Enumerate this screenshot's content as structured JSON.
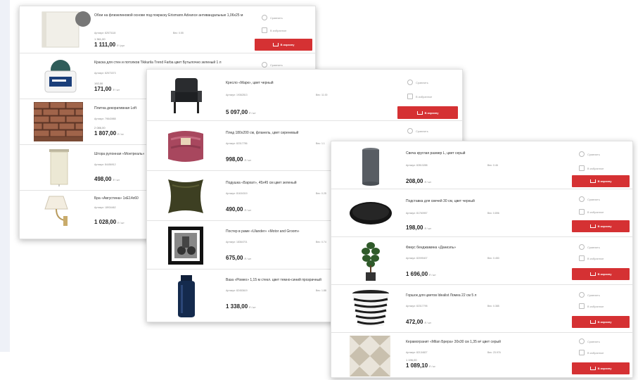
{
  "actions": {
    "compare": "Сравнить",
    "favorite": "В избранное",
    "cart": "В корзину"
  },
  "panel1": {
    "badge": "",
    "rows": [
      {
        "title": "Обои на флизелиновой основе под покраску Erismann Advance антивандальные 1,06х25 м",
        "sku": "Артикул: 82573118",
        "size": "Вес: 0.55",
        "oldprice": "1 361,00",
        "price": "1 111,00",
        "unit": "₽ / рул"
      },
      {
        "title": "Краска для стен и потолков Tikkurila Trend Farba цвет Бутылочно зеленый 1 л",
        "sku": "Артикул: 82573373",
        "size": "",
        "oldprice": "192,00",
        "price": "171,00",
        "unit": "₽ / шт"
      },
      {
        "title": "Плитка декоративная Loft",
        "sku": "Артикул: 79843988",
        "size": "",
        "oldprice": "2 086,00",
        "price": "1 807,00",
        "unit": "₽ / м²"
      },
      {
        "title": "Штора рулонная «Монтреаль»",
        "sku": "Артикул: 84456912",
        "size": "",
        "oldprice": "",
        "price": "498,00",
        "unit": "₽ / шт"
      },
      {
        "title": "Бра «Августина» 1xE14x60",
        "sku": "Артикул: 18934462",
        "size": "",
        "oldprice": "",
        "price": "1 028,00",
        "unit": "₽ / шт"
      }
    ]
  },
  "panel2": {
    "rows": [
      {
        "title": "Кресло «Марк», цвет черный",
        "sku": "Артикул: 19362813",
        "size": "Вес: 11.00",
        "price": "5 097,00",
        "unit": "₽ / шт"
      },
      {
        "title": "Плед 180х200 см, фланель, цвет сиреневый",
        "sku": "Артикул: 82317786",
        "size": "Вес: 1.1",
        "price": "998,00",
        "unit": "₽ / шт"
      },
      {
        "title": "Подушка «Бархат», 45х45 см цвет зеленый",
        "sku": "Артикул: 81634319",
        "size": "Вес: 0.25",
        "price": "490,00",
        "unit": "₽ / шт"
      },
      {
        "title": "Постер в раме «Ulander» «Motor and Groom»",
        "sku": "Артикул: 18364701",
        "size": "Вес: 0.74",
        "price": "675,00",
        "unit": "₽ / шт"
      },
      {
        "title": "Ваза «Ромео» 1,15 м стекл. цвет темно-синий прозрачный",
        "sku": "Артикул: 82453619",
        "size": "Вес: 1.88",
        "price": "1 338,00",
        "unit": "₽ / шт"
      }
    ]
  },
  "panel3": {
    "rows": [
      {
        "title": "Свеча круглая размер L, цвет серый",
        "sku": "Артикул: 82813288",
        "size": "Вес: 0.46",
        "oldprice": "",
        "price": "208,00",
        "unit": "₽ / шт"
      },
      {
        "title": "Подставка для свечей 30 см, цвет черный",
        "sku": "Артикул: 81760957",
        "size": "Вес: 0.896",
        "oldprice": "",
        "price": "198,00",
        "unit": "₽ / шт"
      },
      {
        "title": "Фикус бенджамина «Даниэль»",
        "sku": "Артикул: 82099407",
        "size": "Вес: 0.450",
        "oldprice": "",
        "price": "1 696,00",
        "unit": "₽ / шт"
      },
      {
        "title": "Горшок для цветов Idealist Ломеа 22 см 5 л",
        "sku": "Артикул: 82317795",
        "size": "Вес: 0.385",
        "oldprice": "",
        "price": "472,00",
        "unit": "₽ / шт"
      },
      {
        "title": "Керамогранит «Milan Брера» 30х30 см 1,35 м² цвет серый",
        "sku": "Артикул: 82134827",
        "size": "Вес: 23.976",
        "oldprice": "1 196,00",
        "price": "1 089,10",
        "unit": "₽ / м²"
      }
    ]
  },
  "colors": {
    "accent": "#d53133",
    "text": "#333333",
    "muted": "#888888"
  }
}
